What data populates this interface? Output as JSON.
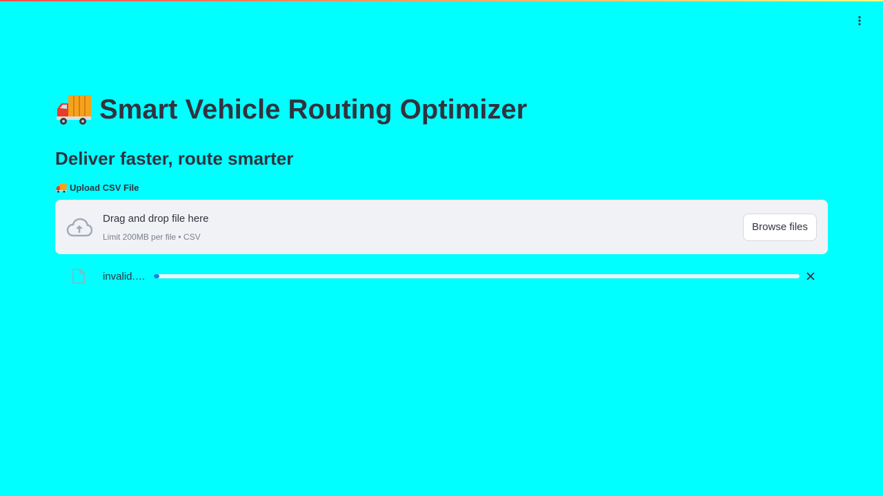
{
  "app": {
    "title": "Smart Vehicle Routing Optimizer",
    "subtitle": "Deliver faster, route smarter",
    "title_icon": "delivery-truck-icon",
    "menu_icon": "vertical-ellipsis-icon"
  },
  "uploader": {
    "label": "Upload CSV File",
    "label_icon": "delivery-truck-icon",
    "drop_text": "Drag and drop file here",
    "limit_text": "Limit 200MB per file • CSV",
    "browse_label": "Browse files",
    "cloud_icon": "cloud-upload-icon"
  },
  "file": {
    "name": "invalid.…",
    "icon": "file-icon",
    "progress": 0.0,
    "remove_icon": "close-icon"
  },
  "colors": {
    "background": "#00ffff",
    "text": "#31333f",
    "dropzone": "#f0f2f6",
    "progress": "#1c83e1",
    "icon_muted": "#a3a8b8"
  }
}
